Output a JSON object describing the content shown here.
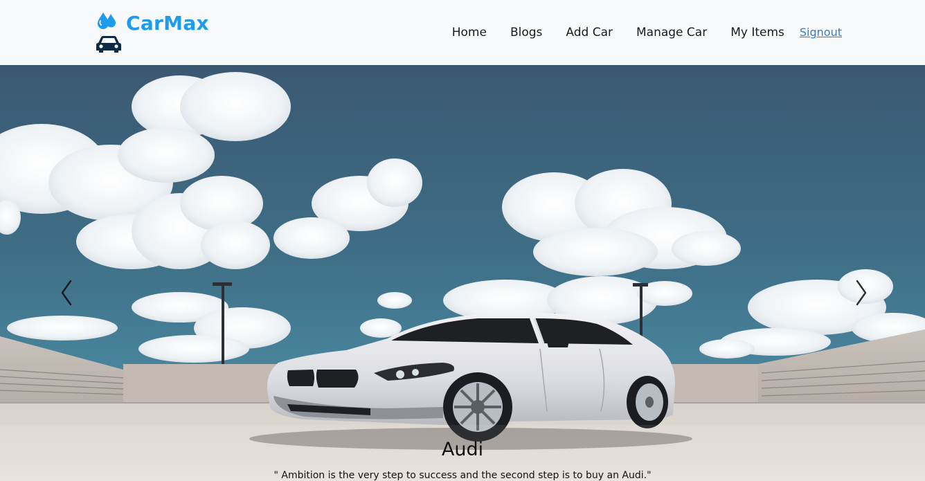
{
  "brand": {
    "name": "CarMax",
    "color": "#1e9bea",
    "icons": [
      "water-drops-icon",
      "car-icon"
    ]
  },
  "nav": {
    "items": [
      {
        "label": "Home"
      },
      {
        "label": "Blogs"
      },
      {
        "label": "Add Car"
      },
      {
        "label": "Manage Car"
      },
      {
        "label": "My Items"
      }
    ],
    "signout_label": "Signout",
    "link_color": "#2f7fd6"
  },
  "carousel": {
    "prev_icon": "chevron-left-icon",
    "next_icon": "chevron-right-icon",
    "slide": {
      "title": "Audi",
      "text": "\" Ambition is the very step to success and the second step is to buy an Audi.\""
    }
  }
}
